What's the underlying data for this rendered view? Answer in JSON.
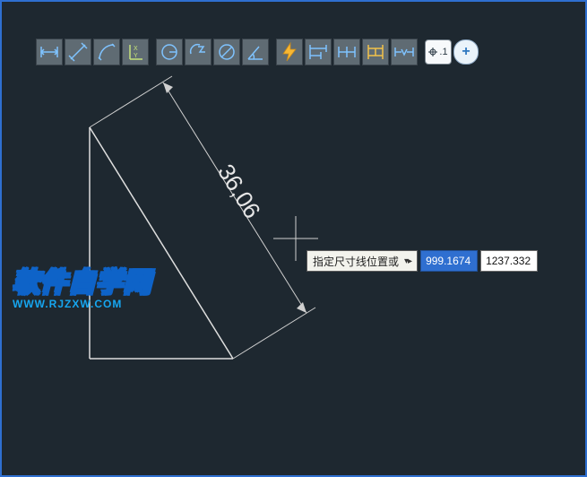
{
  "toolbar": {
    "items": [
      {
        "name": "dim-linear-icon"
      },
      {
        "name": "dim-aligned-icon"
      },
      {
        "name": "dim-arc-icon"
      },
      {
        "name": "dim-ordinate-icon"
      },
      {
        "name": "dim-radius-icon"
      },
      {
        "name": "dim-jogged-icon"
      },
      {
        "name": "dim-diameter-icon"
      },
      {
        "name": "dim-angular-icon"
      },
      {
        "name": "dim-quick-icon"
      },
      {
        "name": "dim-baseline-icon"
      },
      {
        "name": "dim-continue-icon"
      },
      {
        "name": "dim-space-icon"
      },
      {
        "name": "dim-break-icon"
      }
    ],
    "decimal_label": ".1"
  },
  "dimension": {
    "value": "36,06"
  },
  "dynamic_input": {
    "prompt": "指定尺寸线位置或",
    "active_value": "999.1674",
    "secondary_value": "1237.332"
  },
  "watermark": {
    "title": "软件自学网",
    "url": "WWW.RJZXW.COM"
  }
}
